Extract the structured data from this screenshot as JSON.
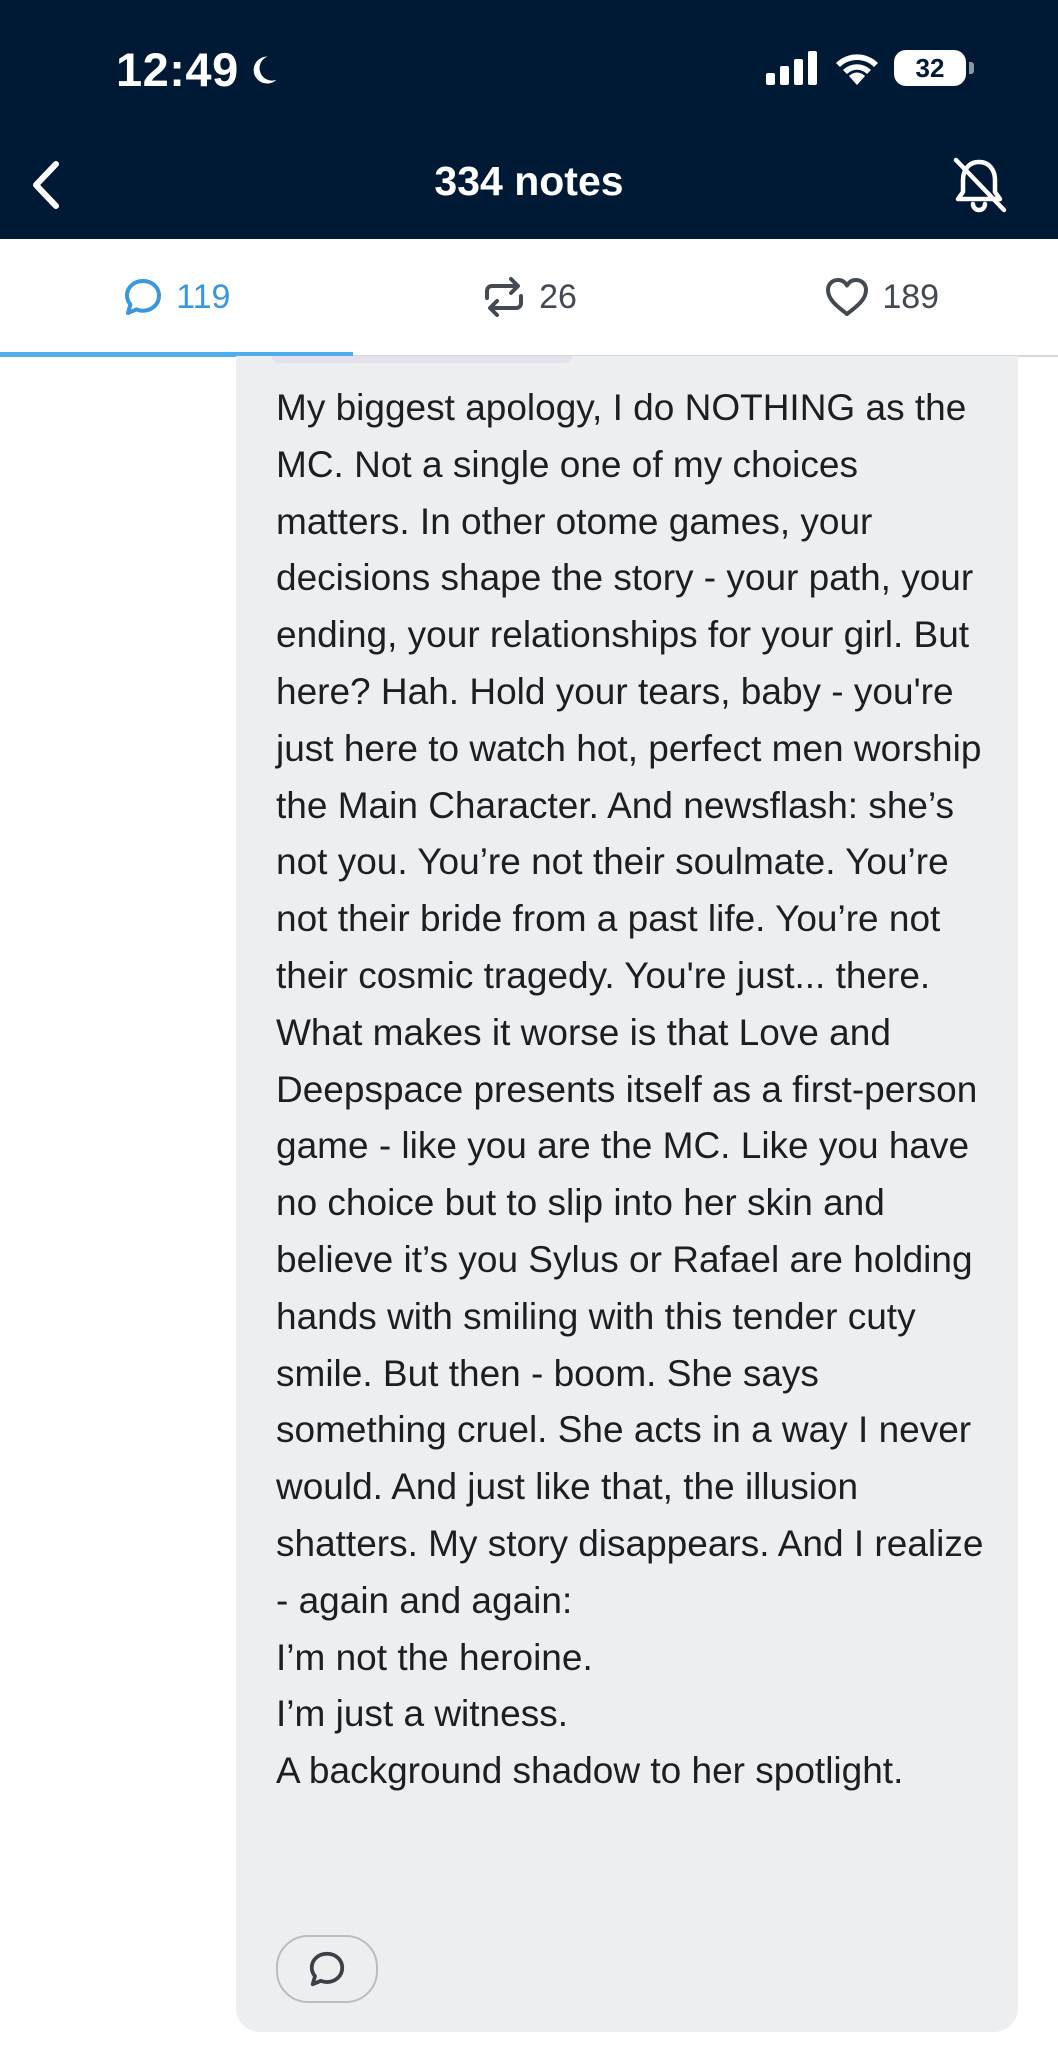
{
  "status_bar": {
    "time": "12:49",
    "battery": "32"
  },
  "header": {
    "title": "334 notes"
  },
  "tabs": [
    {
      "label": "119",
      "icon": "comment-icon",
      "active": true
    },
    {
      "label": "26",
      "icon": "reblog-icon",
      "active": false
    },
    {
      "label": "189",
      "icon": "heart-icon",
      "active": false
    }
  ],
  "comment": {
    "lines": [
      "My biggest apology, I do NOTHING as the MC. Not a single one of my choices matters. In other otome games, your decisions shape the story - your path, your ending, your relationships for your girl. But here? Hah. Hold your tears, baby - you're just here to watch hot, perfect men worship the Main Character. And newsflash: she’s not you. You’re not their soulmate. You’re not their bride from a past life. You’re not their cosmic tragedy. You're just... there. What makes it worse is that Love and Deepspace presents itself as a first-person game - like you are the MC. Like you have no choice but to slip into her skin and believe it’s you Sylus or Rafael are holding hands with smiling with this tender cuty smile. But then - boom. She says something cruel. She acts in a way I never would. And just like that, the illusion shatters. My story disappears. And I realize - again and again:",
      "I’m not the heroine.",
      "I’m just a witness.",
      "A background shadow to her spotlight."
    ]
  },
  "colors": {
    "header_bg": "#001935",
    "accent": "#4faef0",
    "card_bg": "#edeef0"
  }
}
